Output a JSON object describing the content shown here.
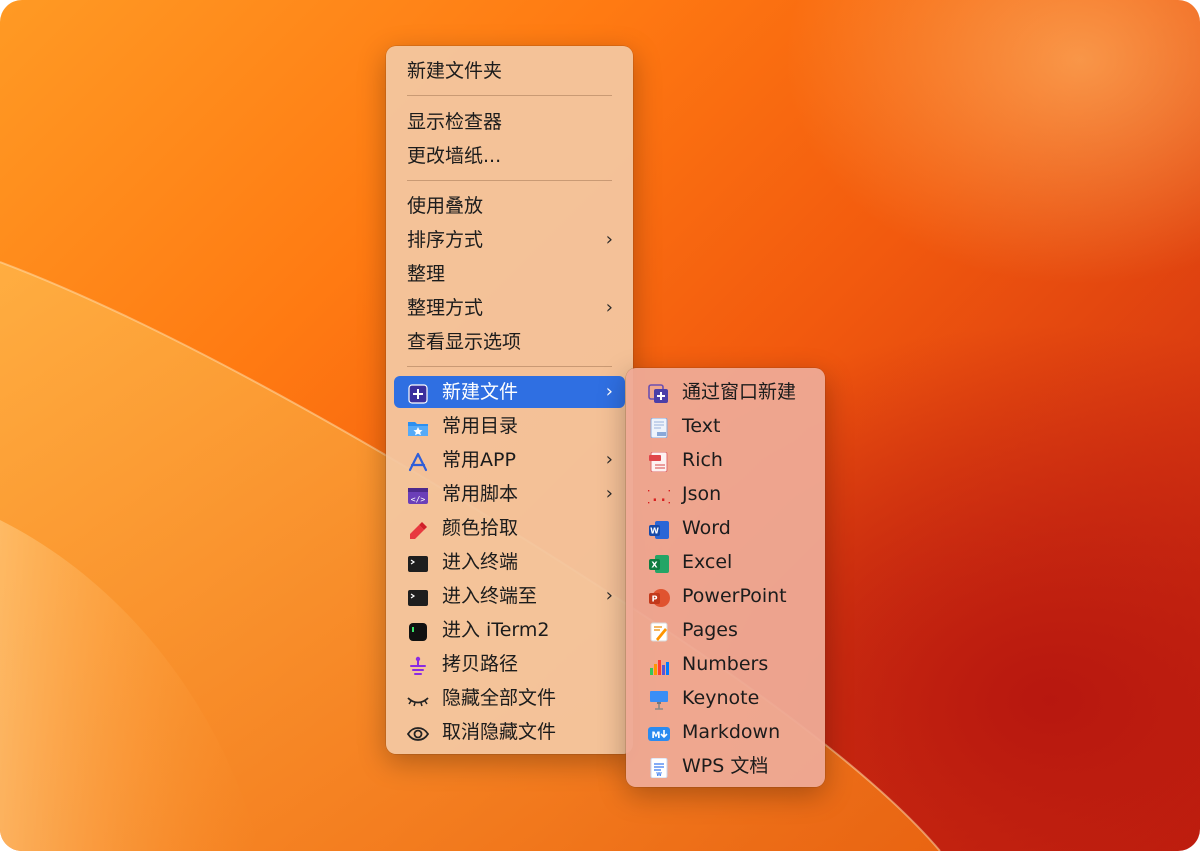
{
  "main_menu": {
    "items": [
      {
        "label": "新建文件夹"
      },
      {
        "label": "显示检查器"
      },
      {
        "label": "更改墙纸..."
      },
      {
        "label": "使用叠放"
      },
      {
        "label": "排序方式"
      },
      {
        "label": "整理"
      },
      {
        "label": "整理方式"
      },
      {
        "label": "查看显示选项"
      },
      {
        "label": "新建文件",
        "icon": "new-file-plus-icon"
      },
      {
        "label": "常用目录",
        "icon": "folder-star-icon"
      },
      {
        "label": "常用APP",
        "icon": "app-store-icon"
      },
      {
        "label": "常用脚本",
        "icon": "script-code-icon"
      },
      {
        "label": "颜色拾取",
        "icon": "eyedropper-icon"
      },
      {
        "label": "进入终端",
        "icon": "terminal-icon"
      },
      {
        "label": "进入终端至",
        "icon": "terminal-icon"
      },
      {
        "label": "进入 iTerm2",
        "icon": "iterm-icon"
      },
      {
        "label": "拷贝路径",
        "icon": "path-icon"
      },
      {
        "label": "隐藏全部文件",
        "icon": "closed-eye-icon"
      },
      {
        "label": "取消隐藏文件",
        "icon": "eye-icon"
      }
    ],
    "submenu_arrow": "›"
  },
  "sub_menu": {
    "items": [
      {
        "label": "通过窗口新建",
        "icon": "new-window-plus-icon"
      },
      {
        "label": "Text",
        "icon": "txt-file-icon"
      },
      {
        "label": "Rich",
        "icon": "rtf-file-icon"
      },
      {
        "label": "Json",
        "icon": "json-braces-icon"
      },
      {
        "label": "Word",
        "icon": "word-icon"
      },
      {
        "label": "Excel",
        "icon": "excel-icon"
      },
      {
        "label": "PowerPoint",
        "icon": "powerpoint-icon"
      },
      {
        "label": "Pages",
        "icon": "pages-icon"
      },
      {
        "label": "Numbers",
        "icon": "numbers-icon"
      },
      {
        "label": "Keynote",
        "icon": "keynote-icon"
      },
      {
        "label": "Markdown",
        "icon": "markdown-icon"
      },
      {
        "label": "WPS 文档",
        "icon": "wps-doc-icon"
      }
    ]
  },
  "colors": {
    "selection": "#2f6fe2",
    "menu_bg": "#f3c7a0",
    "submenu_bg": "#eeaa96",
    "wallpaper_orange": "#ff7a12",
    "wallpaper_red": "#c4230e"
  }
}
